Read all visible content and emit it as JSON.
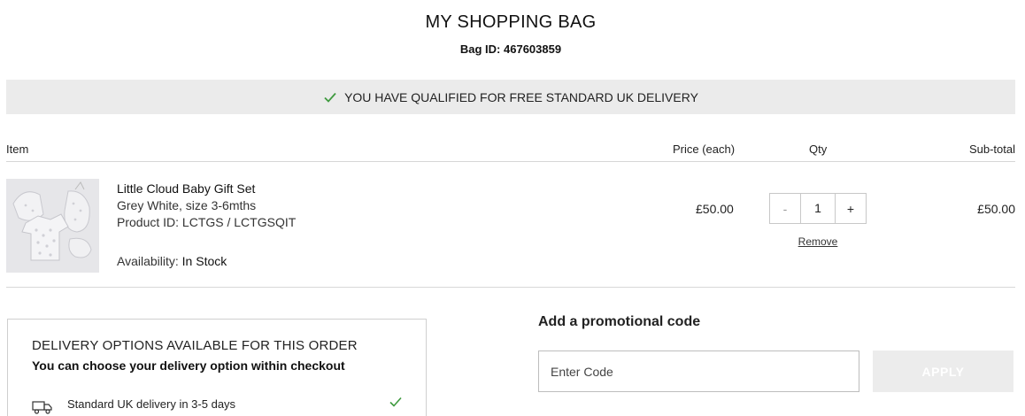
{
  "page": {
    "title": "MY SHOPPING BAG",
    "bag_id_label": "Bag ID:",
    "bag_id": "467603859"
  },
  "banner": {
    "text": "YOU HAVE QUALIFIED FOR FREE STANDARD UK DELIVERY",
    "icon": "check-icon",
    "icon_color": "#3f9a3f"
  },
  "table": {
    "headers": {
      "item": "Item",
      "price": "Price (each)",
      "qty": "Qty",
      "subtotal": "Sub-total"
    }
  },
  "item": {
    "name": "Little Cloud Baby Gift Set",
    "variant": "Grey White, size 3-6mths",
    "product_id": "Product ID: LCTGS / LCTGSQIT",
    "availability_label": "Availability:",
    "availability_value": "In Stock",
    "price": "£50.00",
    "quantity": "1",
    "minus": "-",
    "plus": "+",
    "remove": "Remove",
    "subtotal": "£50.00"
  },
  "delivery": {
    "title": "DELIVERY OPTIONS AVAILABLE FOR THIS ORDER",
    "subtitle": "You can choose your delivery option within checkout",
    "option_label": "Standard UK delivery in 3-5 days",
    "option_icon": "truck-icon"
  },
  "promo": {
    "title": "Add a promotional code",
    "placeholder": "Enter Code",
    "apply": "APPLY"
  }
}
